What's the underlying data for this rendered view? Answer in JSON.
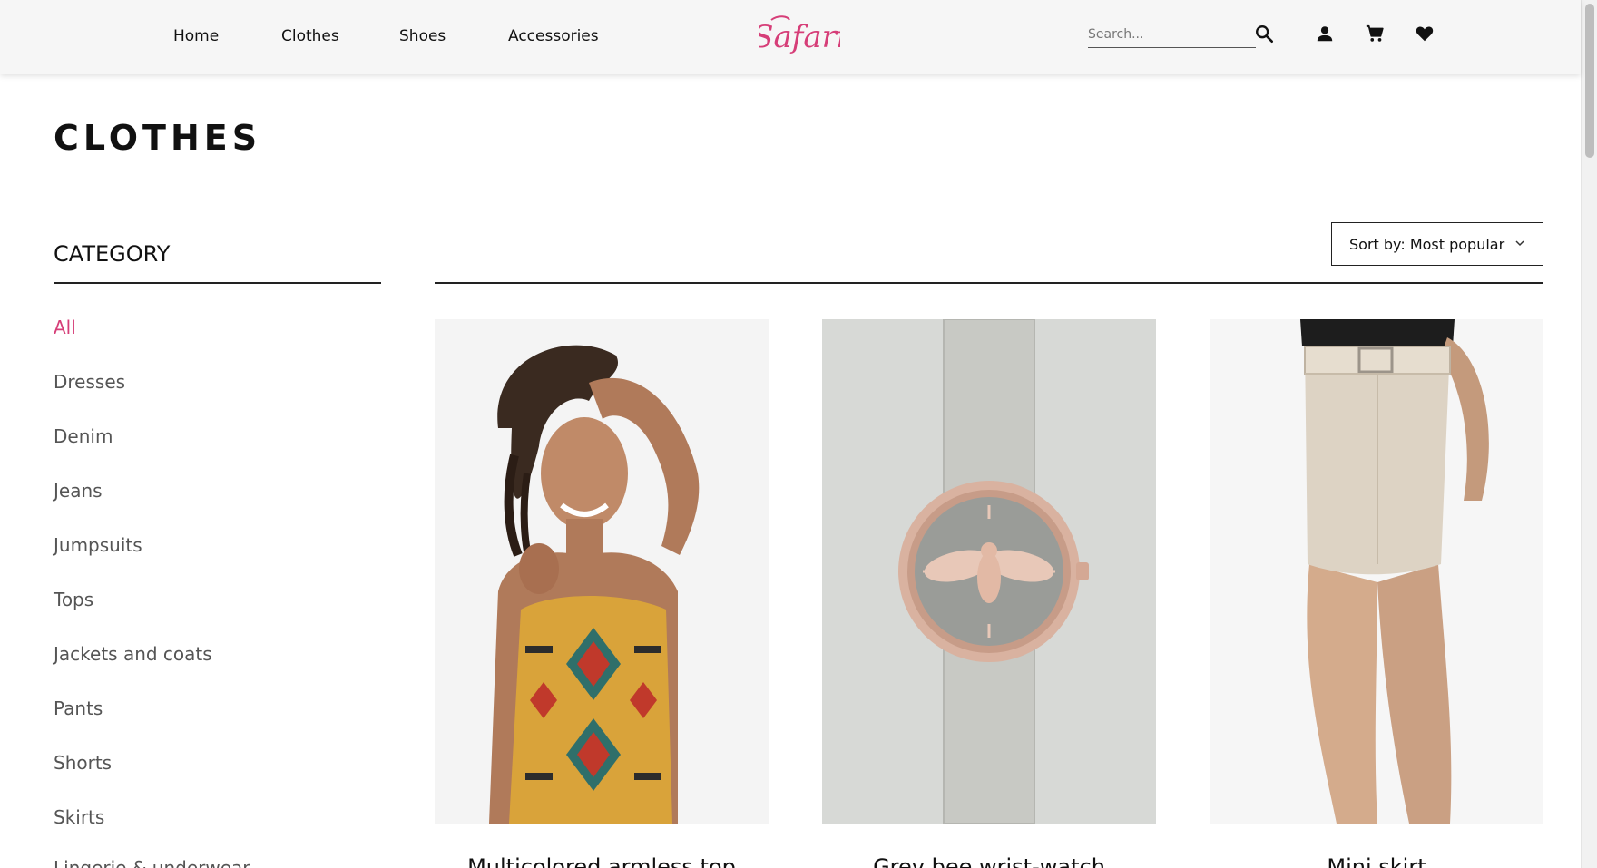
{
  "header": {
    "nav": [
      {
        "label": "Home"
      },
      {
        "label": "Clothes"
      },
      {
        "label": "Shoes"
      },
      {
        "label": "Accessories"
      }
    ],
    "logo_text": "Safari",
    "search_placeholder": "Search...",
    "icons": [
      "search-icon",
      "account-icon",
      "cart-icon",
      "heart-icon"
    ],
    "brand_color": "#d63e78"
  },
  "page_title": "CLOTHES",
  "sidebar": {
    "heading": "CATEGORY",
    "items": [
      {
        "label": "All",
        "active": true
      },
      {
        "label": "Dresses"
      },
      {
        "label": "Denim"
      },
      {
        "label": "Jeans"
      },
      {
        "label": "Jumpsuits"
      },
      {
        "label": "Tops"
      },
      {
        "label": "Jackets and coats"
      },
      {
        "label": "Pants"
      },
      {
        "label": "Shorts"
      },
      {
        "label": "Skirts"
      },
      {
        "label": "Lingerie & underwear"
      }
    ]
  },
  "sort": {
    "label": "Sort by: Most popular"
  },
  "products": [
    {
      "name": "Multicolored armless top"
    },
    {
      "name": "Grey bee wrist-watch"
    },
    {
      "name": "Mini skirt"
    }
  ]
}
